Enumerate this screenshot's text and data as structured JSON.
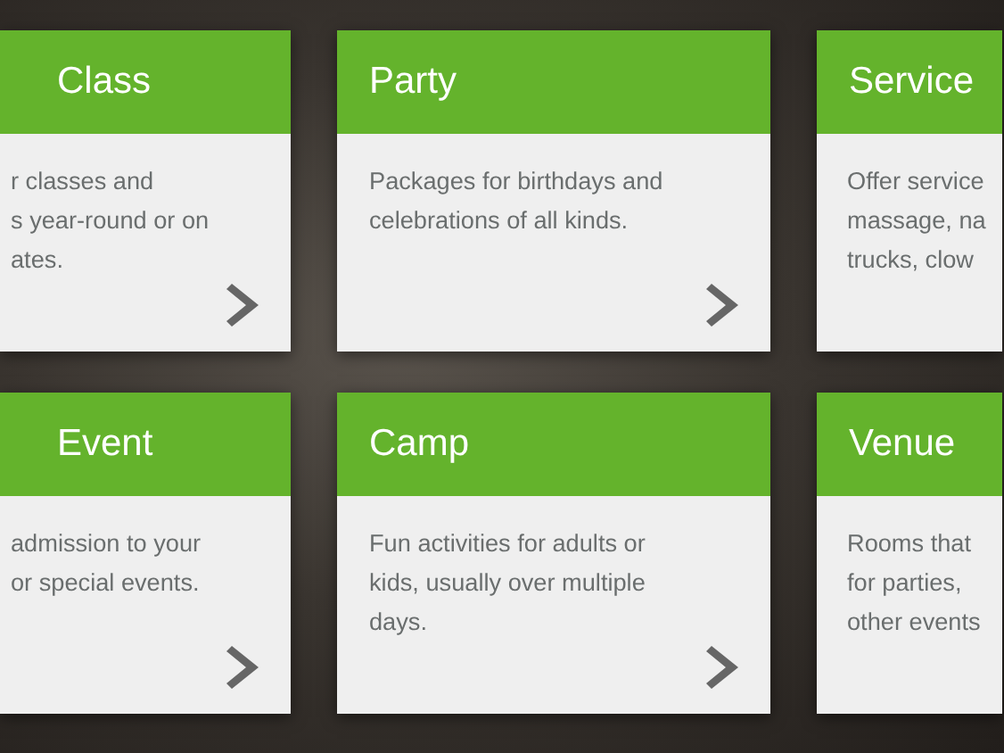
{
  "cards": [
    {
      "title": "Class",
      "lines": [
        "r classes and",
        "s year-round or on",
        "ates."
      ],
      "arrow": true
    },
    {
      "title": "Party",
      "lines": [
        "Packages for birthdays and",
        "celebrations of all kinds."
      ],
      "arrow": true
    },
    {
      "title": "Service",
      "lines": [
        "Offer service",
        "massage, na",
        "trucks, clow"
      ],
      "arrow": false
    },
    {
      "title": "Event",
      "lines": [
        "admission to your",
        "or special events."
      ],
      "arrow": true
    },
    {
      "title": "Camp",
      "lines": [
        "Fun activities for adults or",
        "kids, usually over multiple",
        "days."
      ],
      "arrow": true
    },
    {
      "title": "Venue",
      "lines": [
        "Rooms that",
        "for parties,",
        "other events"
      ],
      "arrow": false
    }
  ]
}
